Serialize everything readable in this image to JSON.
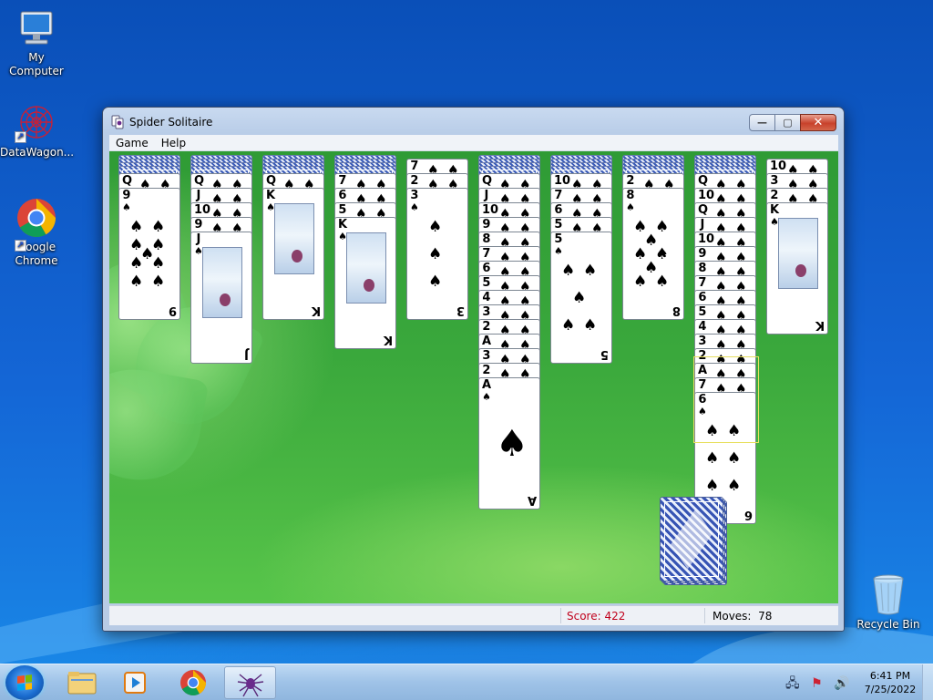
{
  "desktop": {
    "icons": [
      {
        "label": "My Computer",
        "icon": "computer-icon"
      },
      {
        "label": "DataWagon...",
        "icon": "datawagon-icon"
      },
      {
        "label": "Google Chrome",
        "icon": "chrome-icon"
      },
      {
        "label": "Recycle Bin",
        "icon": "recycle-bin-icon"
      }
    ]
  },
  "window": {
    "title": "Spider Solitaire",
    "buttons": {
      "minimize": "—",
      "maximize": "▢",
      "close": "✕"
    },
    "menu": [
      "Game",
      "Help"
    ]
  },
  "status": {
    "score": "Score: 422",
    "moves_label": "Moves:",
    "moves_value": "78"
  },
  "tableau": [
    {
      "down": 4,
      "up": [
        "Q",
        "9"
      ]
    },
    {
      "down": 4,
      "up": [
        "Q",
        "J",
        "10",
        "9",
        "J"
      ]
    },
    {
      "down": 4,
      "up": [
        "Q",
        "K"
      ]
    },
    {
      "down": 4,
      "up": [
        "7",
        "6",
        "5",
        "K"
      ]
    },
    {
      "down": 0,
      "up": [
        "7",
        "2",
        "3"
      ]
    },
    {
      "down": 4,
      "up": [
        "Q",
        "J",
        "10",
        "9",
        "8",
        "7",
        "6",
        "5",
        "4",
        "3",
        "2",
        "A",
        "3",
        "2",
        "A"
      ]
    },
    {
      "down": 4,
      "up": [
        "10",
        "7",
        "6",
        "5",
        "5"
      ]
    },
    {
      "down": 4,
      "up": [
        "2",
        "8"
      ]
    },
    {
      "down": 4,
      "up": [
        "Q",
        "10",
        "Q",
        "J",
        "10",
        "9",
        "8",
        "7",
        "6",
        "5",
        "4",
        "3",
        "2",
        "A",
        "7",
        "6"
      ]
    },
    {
      "down": 0,
      "up": [
        "10",
        "3",
        "2",
        "K"
      ]
    }
  ],
  "stock_piles": 3,
  "colors": {
    "felt": "#3aa83c",
    "score_text": "#c0001b",
    "desktop": "#1466d6"
  },
  "taskbar": {
    "pinned": [
      "windows-explorer-icon",
      "media-player-icon",
      "chrome-icon",
      "spider-solitaire-icon"
    ],
    "tray": {
      "time": "6:41 PM",
      "date": "7/25/2022"
    }
  }
}
